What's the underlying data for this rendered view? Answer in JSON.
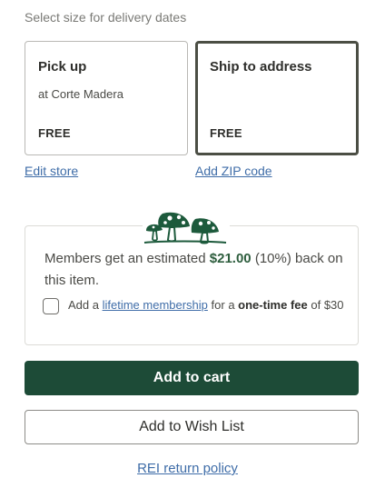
{
  "fulfillment": {
    "hint": "Select size for delivery dates",
    "pickup": {
      "title": "Pick up",
      "subtitle": "at Corte Madera",
      "price": "FREE",
      "link": "Edit store"
    },
    "ship": {
      "title": "Ship to address",
      "price": "FREE",
      "link": "Add ZIP code"
    }
  },
  "membership": {
    "icon": "mushrooms-icon",
    "text_before": "Members get an estimated ",
    "amount": "$21.00",
    "text_after": " (10%) back on this item.",
    "add_prefix": "Add a ",
    "link": "lifetime membership",
    "for_a": " for a ",
    "one_time": "one-time fee",
    "price_suffix": " of $30"
  },
  "actions": {
    "add_to_cart": "Add to cart",
    "add_to_wishlist": "Add to Wish List",
    "return_policy": "REI return policy"
  },
  "colors": {
    "primary_button": "#1d4b37",
    "link": "#3f6da8",
    "selected_border": "#4b4e44"
  }
}
